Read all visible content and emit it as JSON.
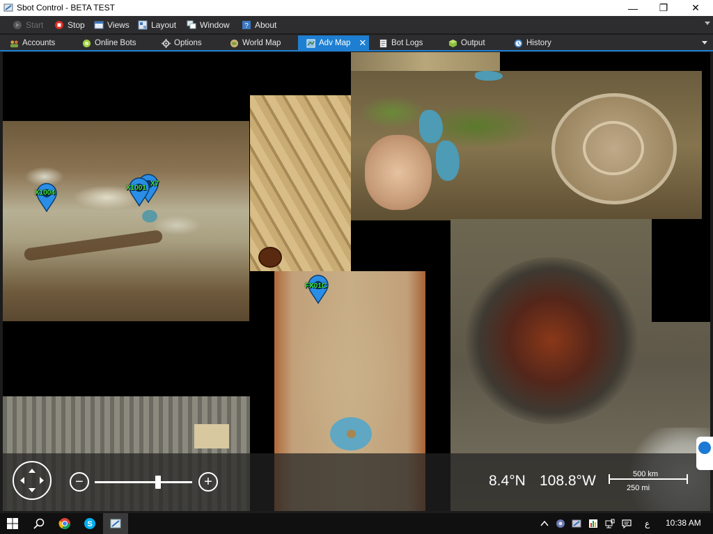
{
  "window": {
    "title": "Sbot Control - BETA TEST",
    "minimize_glyph": "—",
    "maximize_glyph": "❐",
    "close_glyph": "✕"
  },
  "menu": {
    "items": [
      {
        "label": "Start",
        "icon": "play-icon",
        "enabled": false
      },
      {
        "label": "Stop",
        "icon": "stop-icon",
        "enabled": true
      },
      {
        "label": "Views",
        "icon": "views-icon",
        "enabled": true
      },
      {
        "label": "Layout",
        "icon": "layout-icon",
        "enabled": true
      },
      {
        "label": "Window",
        "icon": "window-icon",
        "enabled": true
      },
      {
        "label": "About",
        "icon": "help-icon",
        "enabled": true
      }
    ]
  },
  "tabs": {
    "items": [
      {
        "label": "Accounts",
        "icon": "accounts-icon"
      },
      {
        "label": "Online Bots",
        "icon": "online-bots-icon"
      },
      {
        "label": "Options",
        "icon": "gear-icon"
      },
      {
        "label": "World Map",
        "icon": "world-map-icon"
      },
      {
        "label": "Adv Map",
        "icon": "adv-map-icon",
        "active": true
      },
      {
        "label": "Bot Logs",
        "icon": "logs-icon"
      },
      {
        "label": "Output",
        "icon": "output-icon"
      },
      {
        "label": "History",
        "icon": "history-icon"
      }
    ],
    "close_glyph": "✕"
  },
  "map": {
    "markers": [
      {
        "label": "X1004"
      },
      {
        "label": "X1001"
      },
      {
        "label": "X7"
      },
      {
        "label": "FX01C"
      }
    ],
    "controls": {
      "zoom_out_glyph": "−",
      "zoom_in_glyph": "+",
      "zoom_level": 0.65
    },
    "latitude": "8.4°N",
    "longitude": "108.8°W",
    "scale_km": "500 km",
    "scale_mi": "250 mi"
  },
  "taskbar": {
    "language": "ع",
    "clock": "10:38 AM"
  },
  "colors": {
    "accent": "#1e7fd2",
    "marker_blue": "#2a8ee6",
    "marker_label": "#3ee53e",
    "menu_bg": "#2d2d30"
  }
}
